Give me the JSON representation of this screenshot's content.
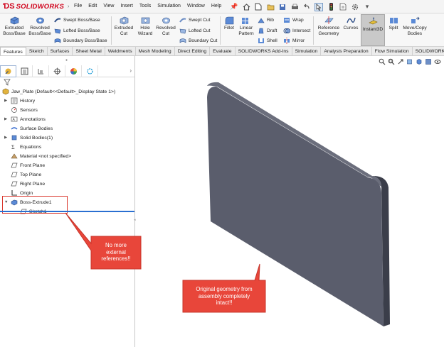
{
  "app": {
    "name": "SOLIDWORKS",
    "menu": [
      "File",
      "Edit",
      "View",
      "Insert",
      "Tools",
      "Simulation",
      "Window",
      "Help"
    ]
  },
  "ribbon": {
    "extruded_boss": "Extruded\nBoss/Base",
    "revolved_boss": "Revolved\nBoss/Base",
    "swept_boss": "Swept Boss/Base",
    "lofted_boss": "Lofted Boss/Base",
    "boundary_boss": "Boundary Boss/Base",
    "extruded_cut": "Extruded\nCut",
    "hole_wizard": "Hole\nWizard",
    "revolved_cut": "Revolved\nCut",
    "swept_cut": "Swept Cut",
    "lofted_cut": "Lofted Cut",
    "boundary_cut": "Boundary Cut",
    "fillet": "Fillet",
    "linear_pattern": "Linear\nPattern",
    "rib": "Rib",
    "draft": "Draft",
    "shell": "Shell",
    "wrap": "Wrap",
    "intersect": "Intersect",
    "mirror": "Mirror",
    "reference_geometry": "Reference\nGeometry",
    "curves": "Curves",
    "instant3d": "Instant3D",
    "split": "Split",
    "move_copy": "Move/Copy\nBodies"
  },
  "tabs": [
    "Features",
    "Sketch",
    "Surfaces",
    "Sheet Metal",
    "Weldments",
    "Mesh Modeling",
    "Direct Editing",
    "Evaluate",
    "SOLIDWORKS Add-Ins",
    "Simulation",
    "Analysis Preparation",
    "Flow Simulation",
    "SOLIDWORKS"
  ],
  "tree": {
    "root": "Jaw_Plate  (Default<<Default>_Display State 1>)",
    "history": "History",
    "sensors": "Sensors",
    "annotations": "Annotations",
    "surface_bodies": "Surface Bodies",
    "solid_bodies": "Solid Bodies(1)",
    "equations": "Equations",
    "material": "Material <not specified>",
    "front_plane": "Front Plane",
    "top_plane": "Top Plane",
    "right_plane": "Right Plane",
    "origin": "Origin",
    "boss_extrude": "Boss-Extrude1",
    "sketch": "Sketch1"
  },
  "callouts": {
    "no_refs": "No more\nexternal\nreferences!!",
    "original": "Original geometry from\nassembly completely\nintact!!"
  },
  "colors": {
    "accent_red": "#d0021b",
    "callout_fill": "#e8463a",
    "plate_front": "#5c5f6e",
    "plate_side": "#3a3d49",
    "selection_blue": "#2a6fd1"
  }
}
